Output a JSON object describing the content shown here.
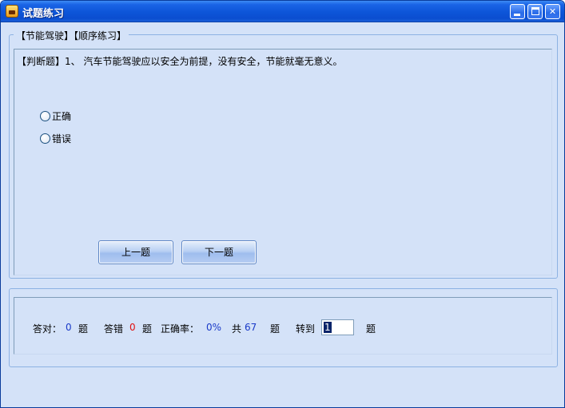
{
  "window": {
    "title": "试题练习"
  },
  "practice": {
    "legend": "【节能驾驶】【顺序练习】",
    "question": "【判断题】1、 汽车节能驾驶应以安全为前提，没有安全，节能就毫无意义。",
    "options": [
      "正确",
      "错误"
    ],
    "prev_label": "上一题",
    "next_label": "下一题"
  },
  "status": {
    "correct_label": "答对：",
    "correct_count": "0",
    "wrong_label": "答错",
    "wrong_count": "0",
    "unit": "题",
    "rate_label": "正确率：",
    "rate_value": "0%",
    "total_label": "共",
    "total_count": "67",
    "goto_label": "转到",
    "goto_value": "1"
  },
  "colors": {
    "title_bar": "#0d55d8",
    "window_bg": "#d4e2f8",
    "correct_count": "#1a3ac8",
    "wrong_count": "#e01010"
  }
}
